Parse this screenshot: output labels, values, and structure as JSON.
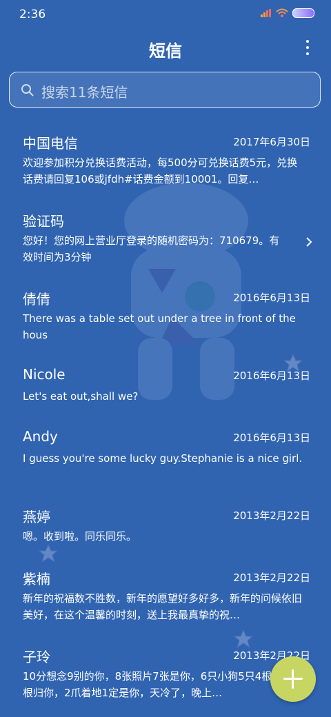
{
  "status_bar": {
    "time": "2:36"
  },
  "header": {
    "title": "短信"
  },
  "search": {
    "placeholder": "搜索11条短信"
  },
  "messages": [
    {
      "sender": "中国电信",
      "date": "2017年6月30日",
      "preview": "欢迎参加积分兑换话费活动，每500分可兑换话费5元，兑换话费请回复106或jfdh#话费金额到10001。回复…"
    },
    {
      "sender": "验证码",
      "date": "",
      "preview": "您好！您的网上营业厅登录的随机密码为：710679。有效时间为3分钟"
    },
    {
      "sender": "倩倩",
      "date": "2016年6月13日",
      "preview": "There was a table set out under a tree in front of the hous"
    },
    {
      "sender": "Nicole",
      "date": "2016年6月13日",
      "preview": "Let's eat out,shall we?"
    },
    {
      "sender": "Andy",
      "date": "2016年6月13日",
      "preview": "I guess you're some lucky guy.Stephanie is a nice girl."
    },
    {
      "sender": "燕婷",
      "date": "2013年2月22日",
      "preview": "嗯。收到啦。同乐同乐。"
    },
    {
      "sender": "紫楠",
      "date": "2013年2月22日",
      "preview": "新年的祝福数不胜数，新年的愿望好多好多，新年的问候依旧美好，在这个温馨的时刻，送上我最真挚的祝…"
    },
    {
      "sender": "子玲",
      "date": "2013年2月22日",
      "preview": "10分想念9别的你，8张照片7张是你，6只小狗5只4根骨头3根归你，2爪着地1定是你，天冷了，晚上…"
    }
  ],
  "icons": {
    "search": "search-icon",
    "more": "more-vertical-icon",
    "chevron": "chevron-right-icon",
    "fab": "plus-icon",
    "wifi": "wifi-icon",
    "signal": "signal-icon",
    "battery": "battery-icon"
  },
  "colors": {
    "background": "#3064b1",
    "fab": "#c7d662",
    "text": "#ffffff"
  }
}
